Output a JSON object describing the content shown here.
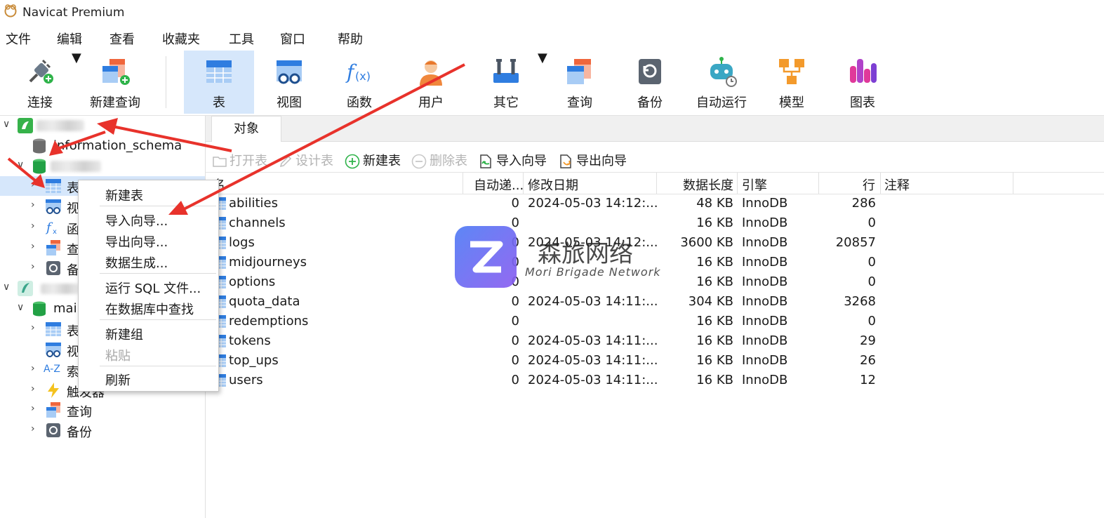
{
  "app": {
    "title": "Navicat Premium"
  },
  "menu": [
    "文件",
    "编辑",
    "查看",
    "收藏夹",
    "工具",
    "窗口",
    "帮助"
  ],
  "toolbar": {
    "connect": "连接",
    "new_query": "新建查询",
    "table": "表",
    "view": "视图",
    "function": "函数",
    "user": "用户",
    "other": "其它",
    "query": "查询",
    "backup": "备份",
    "automation": "自动运行",
    "model": "模型",
    "chart": "图表"
  },
  "sidebar": {
    "schema": "information_schema",
    "table": "表",
    "view": "视",
    "function": "函",
    "query": "查",
    "backup": "备",
    "main_db": "mai",
    "main_table": "表",
    "main_view": "视",
    "main_index": "索",
    "main_trigger": "触发器",
    "main_query": "查询",
    "main_backup": "备份"
  },
  "tabs": {
    "objects": "对象"
  },
  "objbar": {
    "open_table": "打开表",
    "design_table": "设计表",
    "new_table": "新建表",
    "delete_table": "删除表",
    "import_wizard": "导入向导",
    "export_wizard": "导出向导"
  },
  "columns": {
    "name": "名",
    "auto_inc": "自动递...",
    "modified": "修改日期",
    "data_length": "数据长度",
    "engine": "引擎",
    "rows": "行",
    "comment": "注释"
  },
  "tables": [
    {
      "name": "abilities",
      "auto_inc": "0",
      "modified": "2024-05-03 14:12:...",
      "size": "48 KB",
      "engine": "InnoDB",
      "rows": "286"
    },
    {
      "name": "channels",
      "auto_inc": "0",
      "modified": "",
      "size": "16 KB",
      "engine": "InnoDB",
      "rows": "0"
    },
    {
      "name": "logs",
      "auto_inc": "0",
      "modified": "2024-05-03 14:12:...",
      "size": "3600 KB",
      "engine": "InnoDB",
      "rows": "20857"
    },
    {
      "name": "midjourneys",
      "auto_inc": "0",
      "modified": "",
      "size": "16 KB",
      "engine": "InnoDB",
      "rows": "0"
    },
    {
      "name": "options",
      "auto_inc": "0",
      "modified": "",
      "size": "16 KB",
      "engine": "InnoDB",
      "rows": "0"
    },
    {
      "name": "quota_data",
      "auto_inc": "0",
      "modified": "2024-05-03 14:11:...",
      "size": "304 KB",
      "engine": "InnoDB",
      "rows": "3268"
    },
    {
      "name": "redemptions",
      "auto_inc": "0",
      "modified": "",
      "size": "16 KB",
      "engine": "InnoDB",
      "rows": "0"
    },
    {
      "name": "tokens",
      "auto_inc": "0",
      "modified": "2024-05-03 14:11:...",
      "size": "16 KB",
      "engine": "InnoDB",
      "rows": "29"
    },
    {
      "name": "top_ups",
      "auto_inc": "0",
      "modified": "2024-05-03 14:11:...",
      "size": "16 KB",
      "engine": "InnoDB",
      "rows": "26"
    },
    {
      "name": "users",
      "auto_inc": "0",
      "modified": "2024-05-03 14:11:...",
      "size": "16 KB",
      "engine": "InnoDB",
      "rows": "12"
    }
  ],
  "context_menu": {
    "new_table": "新建表",
    "import_wizard": "导入向导...",
    "export_wizard": "导出向导...",
    "data_generation": "数据生成...",
    "run_sql": "运行 SQL 文件...",
    "find_in_db": "在数据库中查找",
    "new_group": "新建组",
    "paste": "粘贴",
    "refresh": "刷新"
  },
  "watermark": {
    "title": "森旅网络",
    "subtitle": "Mori Brigade Network"
  },
  "colors": {
    "accent": "#2f7de0",
    "selection": "#d6e7fb",
    "arrow": "#e8322b"
  }
}
